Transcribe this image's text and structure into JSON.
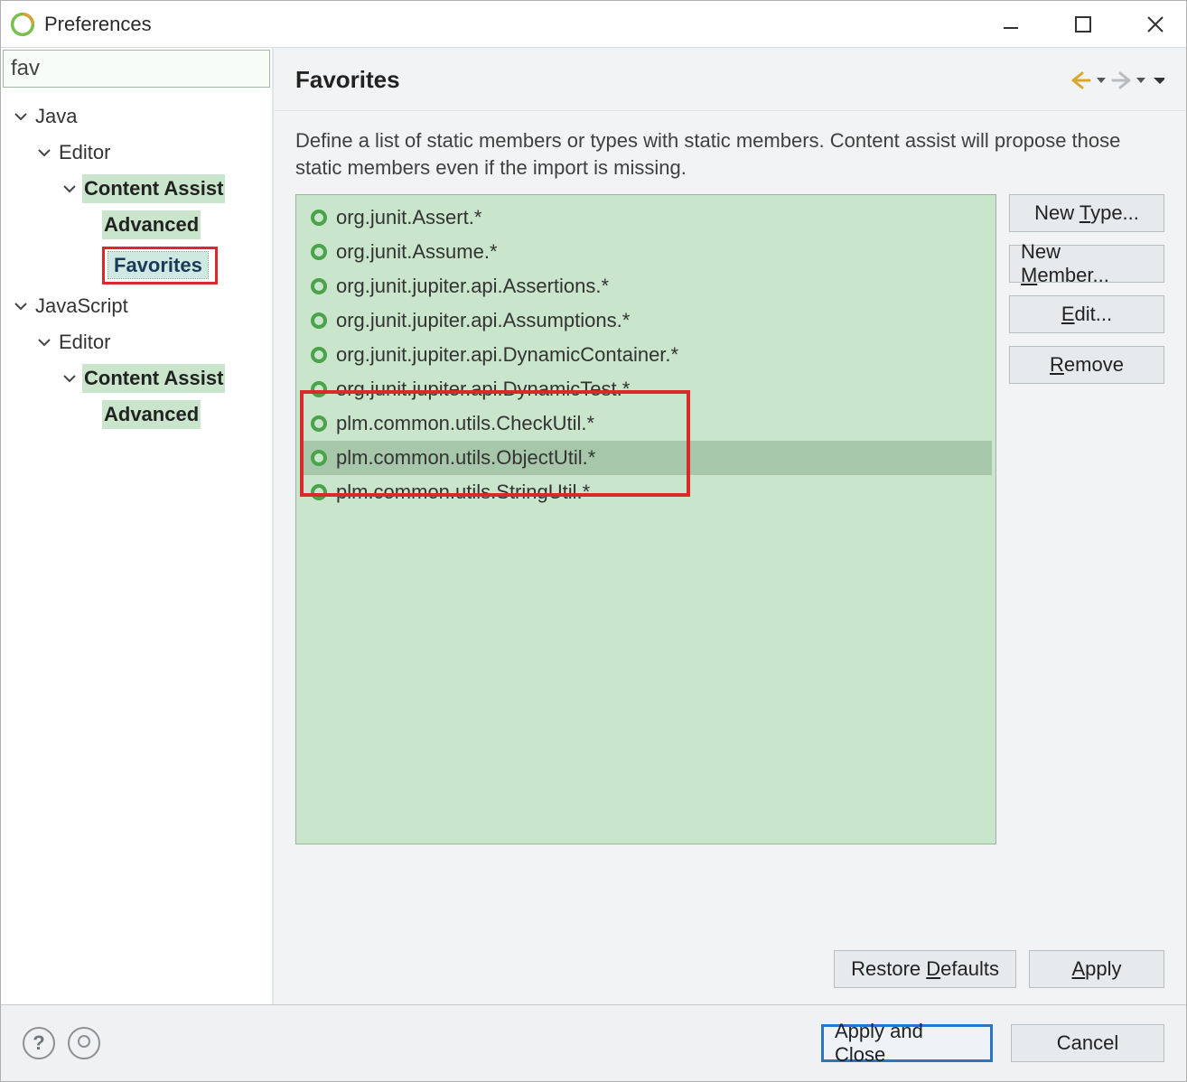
{
  "window": {
    "title": "Preferences",
    "search_value": "fav"
  },
  "tree": {
    "java": "Java",
    "java_editor": "Editor",
    "java_content_assist": "Content Assist",
    "java_advanced": "Advanced",
    "java_favorites": "Favorites",
    "js": "JavaScript",
    "js_editor": "Editor",
    "js_content_assist": "Content Assist",
    "js_advanced": "Advanced"
  },
  "page": {
    "title": "Favorites",
    "description": "Define a list of static members or types with static members. Content assist will propose those static members even if the import is missing."
  },
  "favorites": [
    "org.junit.Assert.*",
    "org.junit.Assume.*",
    "org.junit.jupiter.api.Assertions.*",
    "org.junit.jupiter.api.Assumptions.*",
    "org.junit.jupiter.api.DynamicContainer.*",
    "org.junit.jupiter.api.DynamicTest.*",
    "plm.common.utils.CheckUtil.*",
    "plm.common.utils.ObjectUtil.*",
    "plm.common.utils.StringUtil.*"
  ],
  "buttons": {
    "new_type": "New Type...",
    "new_member": "New Member...",
    "edit": "Edit...",
    "remove": "Remove",
    "restore_defaults": "Restore Defaults",
    "apply": "Apply",
    "apply_close": "Apply and Close",
    "cancel": "Cancel"
  }
}
